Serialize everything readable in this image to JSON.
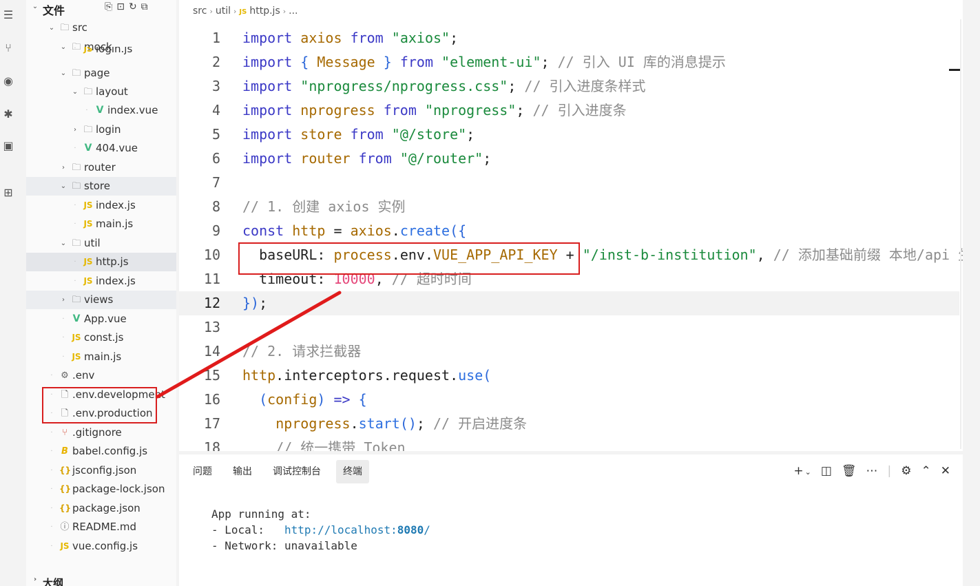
{
  "activity_bar": {
    "icons": [
      "search-list-icon",
      "source-control-icon",
      "debug-eye-icon",
      "bug-icon",
      "remote-screen-icon",
      "extensions-grid-icon"
    ]
  },
  "explorer": {
    "title": "文件",
    "tools": [
      "new-file-icon",
      "new-folder-icon",
      "refresh-icon",
      "collapse-icon"
    ],
    "outline_label": "大纲",
    "items": [
      {
        "label": "src",
        "kind": "folder",
        "open": true
      },
      {
        "label": "mock",
        "kind": "folder",
        "open": true
      },
      {
        "label": "login.js",
        "kind": "js"
      },
      {
        "label": "page",
        "kind": "folder",
        "open": true
      },
      {
        "label": "layout",
        "kind": "folder",
        "open": true
      },
      {
        "label": "index.vue",
        "kind": "vue"
      },
      {
        "label": "login",
        "kind": "folder",
        "open": false
      },
      {
        "label": "404.vue",
        "kind": "vue"
      },
      {
        "label": "router",
        "kind": "folder",
        "open": false
      },
      {
        "label": "store",
        "kind": "folder",
        "open": true
      },
      {
        "label": "index.js",
        "kind": "js"
      },
      {
        "label": "main.js",
        "kind": "js"
      },
      {
        "label": "util",
        "kind": "folder",
        "open": true
      },
      {
        "label": "http.js",
        "kind": "js"
      },
      {
        "label": "index.js",
        "kind": "js"
      },
      {
        "label": "views",
        "kind": "folder",
        "open": false
      },
      {
        "label": "App.vue",
        "kind": "vue"
      },
      {
        "label": "const.js",
        "kind": "js"
      },
      {
        "label": "main.js",
        "kind": "js"
      },
      {
        "label": ".env",
        "kind": "gear"
      },
      {
        "label": ".env.development",
        "kind": "file"
      },
      {
        "label": ".env.production",
        "kind": "file"
      },
      {
        "label": ".gitignore",
        "kind": "git"
      },
      {
        "label": "babel.config.js",
        "kind": "babel"
      },
      {
        "label": "jsconfig.json",
        "kind": "json"
      },
      {
        "label": "package-lock.json",
        "kind": "json"
      },
      {
        "label": "package.json",
        "kind": "json"
      },
      {
        "label": "README.md",
        "kind": "info"
      },
      {
        "label": "vue.config.js",
        "kind": "js"
      }
    ]
  },
  "editor": {
    "breadcrumb": [
      "src",
      "util",
      "http.js",
      "..."
    ],
    "current_line": 12,
    "lines": [
      {
        "n": "1",
        "text": "import axios from \"axios\";"
      },
      {
        "n": "2",
        "text": "import { Message } from \"element-ui\"; // 引入 UI 库的消息提示"
      },
      {
        "n": "3",
        "text": "import \"nprogress/nprogress.css\"; // 引入进度条样式"
      },
      {
        "n": "4",
        "text": "import nprogress from \"nprogress\"; // 引入进度条"
      },
      {
        "n": "5",
        "text": "import store from \"@/store\";"
      },
      {
        "n": "6",
        "text": "import router from \"@/router\";"
      },
      {
        "n": "7",
        "text": ""
      },
      {
        "n": "8",
        "text": "// 1. 创建 axios 实例"
      },
      {
        "n": "9",
        "text": "const http = axios.create({"
      },
      {
        "n": "10",
        "text": "  baseURL: process.env.VUE_APP_API_KEY + \"/inst-b-institution\", // 添加基础前缀 本地/api 生"
      },
      {
        "n": "11",
        "text": "  timeout: 10000, // 超时时间"
      },
      {
        "n": "12",
        "text": "});"
      },
      {
        "n": "13",
        "text": ""
      },
      {
        "n": "14",
        "text": "// 2. 请求拦截器"
      },
      {
        "n": "15",
        "text": "http.interceptors.request.use("
      },
      {
        "n": "16",
        "text": "  (config) => {"
      },
      {
        "n": "17",
        "text": "    nprogress.start(); // 开启进度条"
      },
      {
        "n": "18",
        "text": "    // 统一携带 Token"
      }
    ]
  },
  "panel": {
    "tabs": [
      "问题",
      "输出",
      "调试控制台",
      "终端"
    ],
    "active_tab": "终端",
    "tools": [
      "plus-icon",
      "chevron-down-icon",
      "split-icon",
      "trash-icon",
      "more-icon",
      "settings-icon",
      "maximize-icon",
      "close-icon"
    ],
    "terminal": {
      "line1": "App running at:",
      "local_label": "- Local:   ",
      "local_url": "http://localhost:",
      "local_port": "8080",
      "local_slash": "/",
      "network_label": "- Network: ",
      "network_value": "unavailable"
    }
  },
  "colors": {
    "annotation": "#d81e1e",
    "keyword": "#3b39c6",
    "string": "#1a8a3c",
    "comment": "#8c8c8c",
    "number": "#e5477a"
  }
}
